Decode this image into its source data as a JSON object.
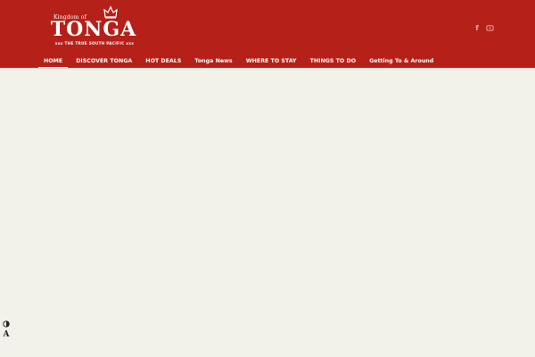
{
  "logo": {
    "kingdom": "Kingdom of",
    "name": "TONGA",
    "tagline": "xxx THE TRUE SOUTH PACIFIC xxx"
  },
  "social": {
    "facebook": "f",
    "youtube_icon": "youtube-icon"
  },
  "nav": {
    "items": [
      {
        "label": "HOME"
      },
      {
        "label": "DISCOVER TONGA"
      },
      {
        "label": "HOT DEALS"
      },
      {
        "label": "Tonga News"
      },
      {
        "label": "WHERE TO STAY"
      },
      {
        "label": "THINGS TO DO"
      },
      {
        "label": "Getting To & Around"
      }
    ]
  },
  "a11y": {
    "font_label": "A"
  },
  "colors": {
    "header_red": "#b52019",
    "page_bg": "#f2f1ea",
    "icon_pink": "#f1b3ae"
  }
}
